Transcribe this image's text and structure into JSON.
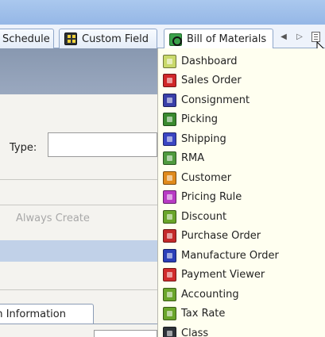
{
  "tabs": [
    {
      "label": "Schedule",
      "icon": "schedule-icon"
    },
    {
      "label": "Custom Field",
      "icon": "custom-field-icon"
    },
    {
      "label": "Bill of Materials",
      "icon": "bill-of-materials-icon"
    }
  ],
  "tab_nav": {
    "prev": "◀",
    "next": "▷"
  },
  "form": {
    "type_label": "Type:",
    "type_value": "",
    "always_create_label": "Always Create",
    "item_tab_label": "Item Information"
  },
  "menu": {
    "items": [
      {
        "label": "Dashboard",
        "icon": "dashboard-icon",
        "color": "#c9d96a"
      },
      {
        "label": "Sales Order",
        "icon": "sales-order-icon",
        "color": "#d02828"
      },
      {
        "label": "Consignment",
        "icon": "consignment-icon",
        "color": "#3a40a8"
      },
      {
        "label": "Picking",
        "icon": "picking-icon",
        "color": "#3a8a2e"
      },
      {
        "label": "Shipping",
        "icon": "shipping-icon",
        "color": "#3b46c2"
      },
      {
        "label": "RMA",
        "icon": "rma-icon",
        "color": "#4f9a3e"
      },
      {
        "label": "Customer",
        "icon": "customer-icon",
        "color": "#e08a1c"
      },
      {
        "label": "Pricing Rule",
        "icon": "pricing-rule-icon",
        "color": "#b83bc4"
      },
      {
        "label": "Discount",
        "icon": "discount-icon",
        "color": "#6aa52a"
      },
      {
        "label": "Purchase Order",
        "icon": "purchase-order-icon",
        "color": "#c42a2a"
      },
      {
        "label": "Manufacture Order",
        "icon": "manufacture-order-icon",
        "color": "#2b3fb8"
      },
      {
        "label": "Payment Viewer",
        "icon": "payment-viewer-icon",
        "color": "#d02c2c"
      },
      {
        "label": "Accounting",
        "icon": "accounting-icon",
        "color": "#6aa52a"
      },
      {
        "label": "Tax Rate",
        "icon": "tax-rate-icon",
        "color": "#6aa52a"
      },
      {
        "label": "Class",
        "icon": "class-icon",
        "color": "#2e3238"
      }
    ]
  }
}
